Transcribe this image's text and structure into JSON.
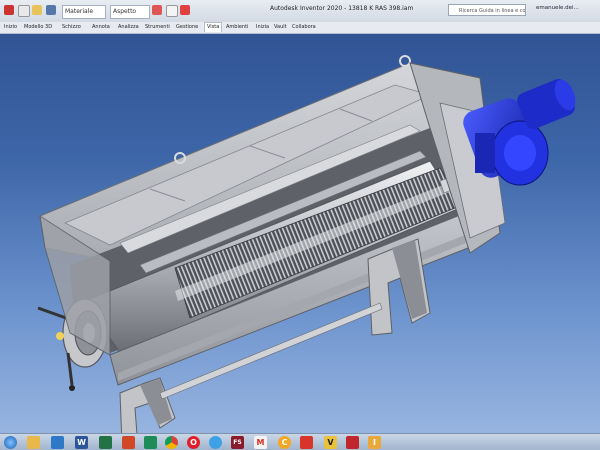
{
  "app": {
    "title": "Autodesk Inventor 2020 - 13818 K RAS 398.iam",
    "quick_access": {
      "material_label": "Materiale",
      "appearance_label": "Aspetto"
    },
    "help_search_placeholder": "Ricerca Guida in linea e comandi",
    "user": "emanuele.dei..."
  },
  "ribbon": {
    "tabs": [
      {
        "label": "Inizio"
      },
      {
        "label": "Modello 3D"
      },
      {
        "label": "Schizzo"
      },
      {
        "label": "Annota"
      },
      {
        "label": "Analizza"
      },
      {
        "label": "Strumenti"
      },
      {
        "label": "Gestione"
      },
      {
        "label": "Vista",
        "active": true
      },
      {
        "label": "Ambienti"
      },
      {
        "label": "Inizia"
      },
      {
        "label": "Vault"
      },
      {
        "label": "Collabora"
      }
    ]
  },
  "viewport": {
    "model": "screw-press-separator-assembly",
    "colors": {
      "housing": "#b9bcc2",
      "motor": "#1f2fd6",
      "screen": "#4a4e55",
      "background_top": "#2e4f8f",
      "background_bottom": "#9db9e2"
    }
  },
  "taskbar": {
    "icons": [
      {
        "name": "start-icon"
      },
      {
        "name": "folder-icon"
      },
      {
        "name": "mail-icon"
      },
      {
        "name": "word-icon",
        "glyph": "W"
      },
      {
        "name": "excel-icon"
      },
      {
        "name": "powerpoint-icon"
      },
      {
        "name": "onenote-icon"
      },
      {
        "name": "chrome-icon"
      },
      {
        "name": "opera-icon",
        "glyph": "O"
      },
      {
        "name": "browser-icon"
      },
      {
        "name": "fs-icon",
        "glyph": "FS"
      },
      {
        "name": "gmail-icon",
        "glyph": "M"
      },
      {
        "name": "c-icon",
        "glyph": "C"
      },
      {
        "name": "video-icon"
      },
      {
        "name": "v-icon",
        "glyph": "V"
      },
      {
        "name": "autocad-icon"
      },
      {
        "name": "inventor-icon",
        "glyph": "I"
      }
    ]
  }
}
